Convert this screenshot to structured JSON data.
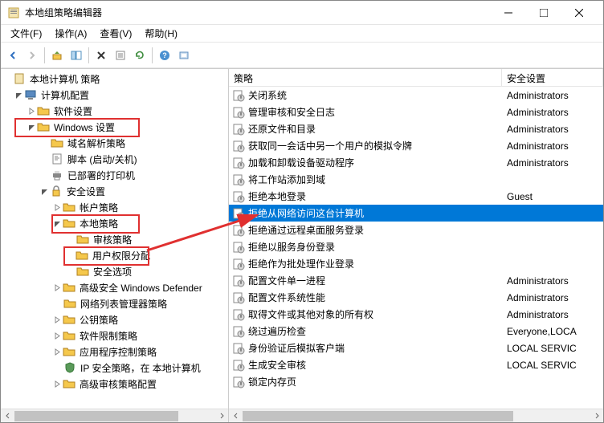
{
  "window": {
    "title": "本地组策略编辑器"
  },
  "menu": {
    "file": "文件(F)",
    "action": "操作(A)",
    "view": "查看(V)",
    "help": "帮助(H)"
  },
  "tree": {
    "root": "本地计算机 策略",
    "computer": "计算机配置",
    "software": "软件设置",
    "windows": "Windows 设置",
    "dns": "域名解析策略",
    "scripts": "脚本 (启动/关机)",
    "printers": "已部署的打印机",
    "security": "安全设置",
    "account": "帐户策略",
    "local": "本地策略",
    "audit": "审核策略",
    "userrights": "用户权限分配",
    "secopt": "安全选项",
    "defender": "高级安全 Windows Defender",
    "netlist": "网络列表管理器策略",
    "pubkey": "公钥策略",
    "softrestrict": "软件限制策略",
    "appctrl": "应用程序控制策略",
    "ipsec": "IP 安全策略，在 本地计算机",
    "advaudit": "高级审核策略配置"
  },
  "list_header": {
    "col1": "策略",
    "col2": "安全设置"
  },
  "policies": [
    {
      "name": "关闭系统",
      "setting": "Administrators"
    },
    {
      "name": "管理审核和安全日志",
      "setting": "Administrators"
    },
    {
      "name": "还原文件和目录",
      "setting": "Administrators"
    },
    {
      "name": "获取同一会话中另一个用户的模拟令牌",
      "setting": "Administrators"
    },
    {
      "name": "加载和卸载设备驱动程序",
      "setting": "Administrators"
    },
    {
      "name": "将工作站添加到域",
      "setting": ""
    },
    {
      "name": "拒绝本地登录",
      "setting": "Guest"
    },
    {
      "name": "拒绝从网络访问这台计算机",
      "setting": "",
      "selected": true
    },
    {
      "name": "拒绝通过远程桌面服务登录",
      "setting": ""
    },
    {
      "name": "拒绝以服务身份登录",
      "setting": ""
    },
    {
      "name": "拒绝作为批处理作业登录",
      "setting": ""
    },
    {
      "name": "配置文件单一进程",
      "setting": "Administrators"
    },
    {
      "name": "配置文件系统性能",
      "setting": "Administrators"
    },
    {
      "name": "取得文件或其他对象的所有权",
      "setting": "Administrators"
    },
    {
      "name": "绕过遍历检查",
      "setting": "Everyone,LOCA"
    },
    {
      "name": "身份验证后模拟客户端",
      "setting": "LOCAL SERVIC"
    },
    {
      "name": "生成安全审核",
      "setting": "LOCAL SERVIC"
    },
    {
      "name": "锁定内存页",
      "setting": ""
    }
  ]
}
